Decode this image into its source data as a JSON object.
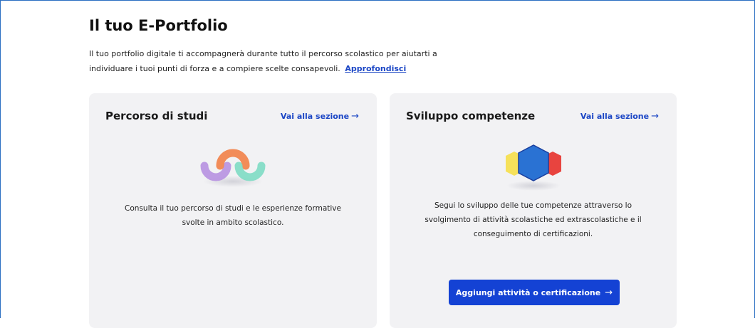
{
  "page": {
    "title": "Il tuo E-Portfolio",
    "intro_text": "Il tuo portfolio digitale ti accompagnerà durante tutto il percorso scolastico per aiutarti a individuare i tuoi punti di forza e a compiere scelte consapevoli.",
    "intro_link": "Approfondisci"
  },
  "cards": [
    {
      "title": "Percorso di studi",
      "link_label": "Vai alla sezione",
      "link_icon": "arrow-right-icon",
      "illustration": "wave-path-illustration",
      "description": "Consulta il tuo percorso di studi e le esperienze formative svolte in ambito scolastico."
    },
    {
      "title": "Sviluppo competenze",
      "link_label": "Vai alla sezione",
      "link_icon": "arrow-right-icon",
      "illustration": "hexagons-illustration",
      "description": "Segui lo sviluppo delle tue competenze attraverso lo svolgimento di attività scolastiche ed extrascolastiche e il conseguimento di certificazioni.",
      "button_label": "Aggiungi attività o certificazione"
    }
  ],
  "colors": {
    "accent": "#1b46c5",
    "button": "#1442d4",
    "card_bg": "#f2f2f4"
  }
}
